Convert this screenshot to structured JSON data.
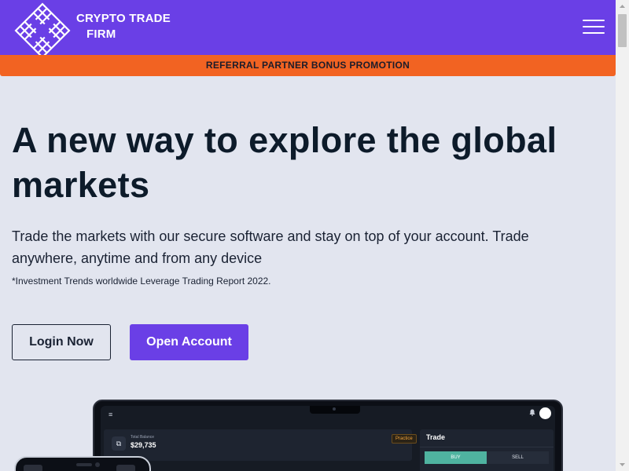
{
  "header": {
    "logo_line1": "CRYPTO TRADE",
    "logo_line2": "FIRM",
    "menu_icon": "hamburger-menu-icon",
    "background": "#6a3fe6"
  },
  "promo": {
    "text": "REFERRAL PARTNER BONUS PROMOTION",
    "background": "#f26322"
  },
  "hero": {
    "title": "A new way to explore the global markets",
    "subtitle": "Trade the markets with our secure software and stay on top of your account. Trade anywhere, anytime and from any device",
    "note": "*Investment Trends worldwide Leverage Trading Report 2022."
  },
  "buttons": {
    "login": "Login Now",
    "open_account": "Open Account"
  },
  "mockup": {
    "menu_glyph": "≡",
    "bell_glyph": "🔔",
    "balance_label": "Total Balance",
    "balance_value": "$29,735",
    "practice_badge": "Practice",
    "trade_title": "Trade",
    "buy_label": "BUY",
    "sell_label": "SELL",
    "buy_color": "#4fb3a0"
  }
}
